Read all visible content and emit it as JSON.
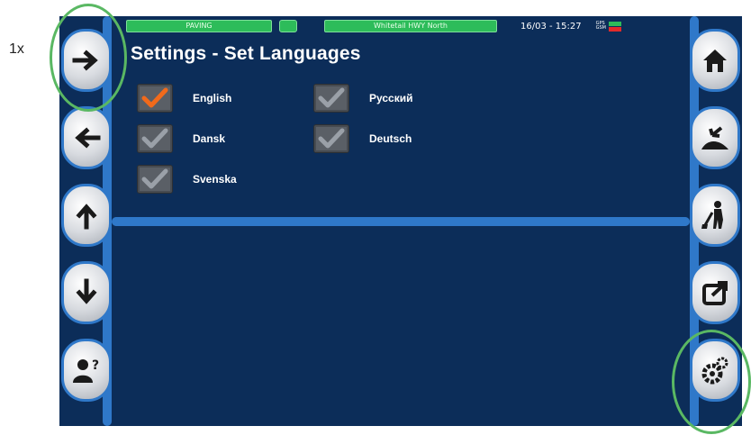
{
  "annotation": {
    "step_label": "1x"
  },
  "statusbar": {
    "mode": "PAVING",
    "road": "Whitetail HWY North",
    "datetime": "16/03 - 15:27",
    "gps_label": "GPS",
    "gsm_label": "GSM",
    "colors": {
      "ok": "#2dbc5a",
      "error": "#e12b2b"
    }
  },
  "page": {
    "title": "Settings - Set Languages"
  },
  "languages": [
    {
      "label": "English",
      "checked": true
    },
    {
      "label": "Русский",
      "checked": false
    },
    {
      "label": "Dansk",
      "checked": false
    },
    {
      "label": "Deutsch",
      "checked": false
    },
    {
      "label": "Svenska",
      "checked": false
    }
  ],
  "left_buttons": [
    {
      "icon": "arrow-right-icon"
    },
    {
      "icon": "arrow-left-icon"
    },
    {
      "icon": "arrow-up-icon"
    },
    {
      "icon": "arrow-down-icon"
    },
    {
      "icon": "user-help-icon"
    }
  ],
  "right_buttons": [
    {
      "icon": "home-icon"
    },
    {
      "icon": "paving-icon"
    },
    {
      "icon": "worker-icon"
    },
    {
      "icon": "export-icon"
    },
    {
      "icon": "gears-icon"
    }
  ],
  "colors": {
    "background": "#0c2d59",
    "accent": "#2f78c9",
    "check_active": "#f26a1b"
  }
}
